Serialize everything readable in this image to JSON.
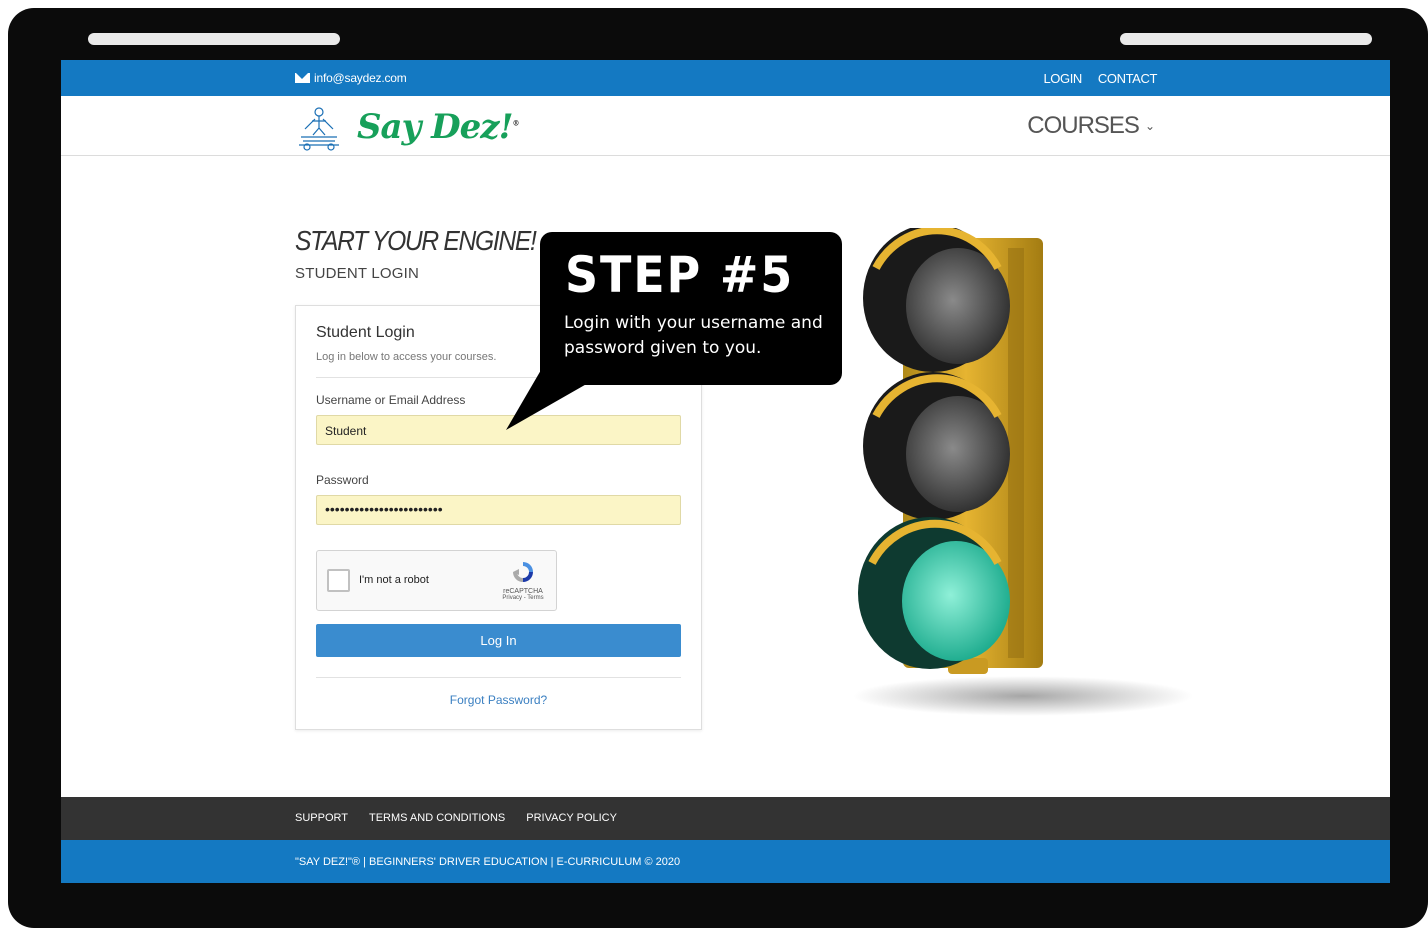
{
  "topbar": {
    "email": "info@saydez.com",
    "login_label": "LOGIN",
    "contact_label": "CONTACT"
  },
  "header": {
    "logo_text": "Say Dez!",
    "logo_registered": "®",
    "courses_label": "COURSES",
    "courses_chevron": "⌄"
  },
  "main": {
    "headline": "START YOUR ENGINE!",
    "subhead": "STUDENT LOGIN"
  },
  "login_card": {
    "title": "Student Login",
    "description": "Log in below to access your courses.",
    "username_label": "Username or Email Address",
    "username_value": "Student",
    "password_label": "Password",
    "password_value": "••••••••••••••••••••••••",
    "captcha_label": "I'm not a robot",
    "captcha_brand": "reCAPTCHA",
    "captcha_terms": "Privacy - Terms",
    "login_button": "Log In",
    "forgot_link": "Forgot Password?"
  },
  "callout": {
    "step": "STEP #5",
    "text": "Login with your username and password given to you."
  },
  "footer": {
    "links": [
      "SUPPORT",
      "TERMS AND CONDITIONS",
      "PRIVACY POLICY"
    ],
    "copyright": "\"SAY DEZ!\"® | BEGINNERS' DRIVER EDUCATION | E-CURRICULUM © 2020"
  },
  "colors": {
    "brand_blue": "#1479c2",
    "button_blue": "#3a8ccf",
    "autofill_yellow": "#fbf5c6",
    "logo_green": "#17a05a",
    "footer_dark": "#333333"
  },
  "icons": {
    "email": "envelope-icon",
    "logo_mark": "driver-figure-icon",
    "captcha": "recaptcha-icon",
    "traffic_light": "traffic-light-image"
  }
}
